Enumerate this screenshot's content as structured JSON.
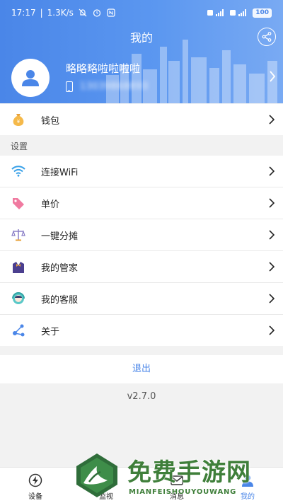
{
  "statusbar": {
    "time": "17:17",
    "speed": "1.3K/s",
    "battery": "100"
  },
  "header": {
    "title": "我的",
    "username": "略略略啦啦啦啦",
    "phone": "13039868893"
  },
  "menu": {
    "wallet": "钱包",
    "section_settings": "设置",
    "wifi": "连接WiFi",
    "price": "单价",
    "split": "一键分摊",
    "butler": "我的管家",
    "service": "我的客服",
    "about": "关于"
  },
  "logout_label": "退出",
  "version": "v2.7.0",
  "bottom_nav": {
    "devices": "设备",
    "monitor": "监视",
    "messages": "消息",
    "mine": "我的"
  },
  "watermark": {
    "title": "免费手游网",
    "subtitle": "MIANFEISHOUYOUWANG"
  },
  "colors": {
    "primary": "#4a86e8",
    "background": "#f2f2f2",
    "watermark_green": "#3f7f3a"
  }
}
